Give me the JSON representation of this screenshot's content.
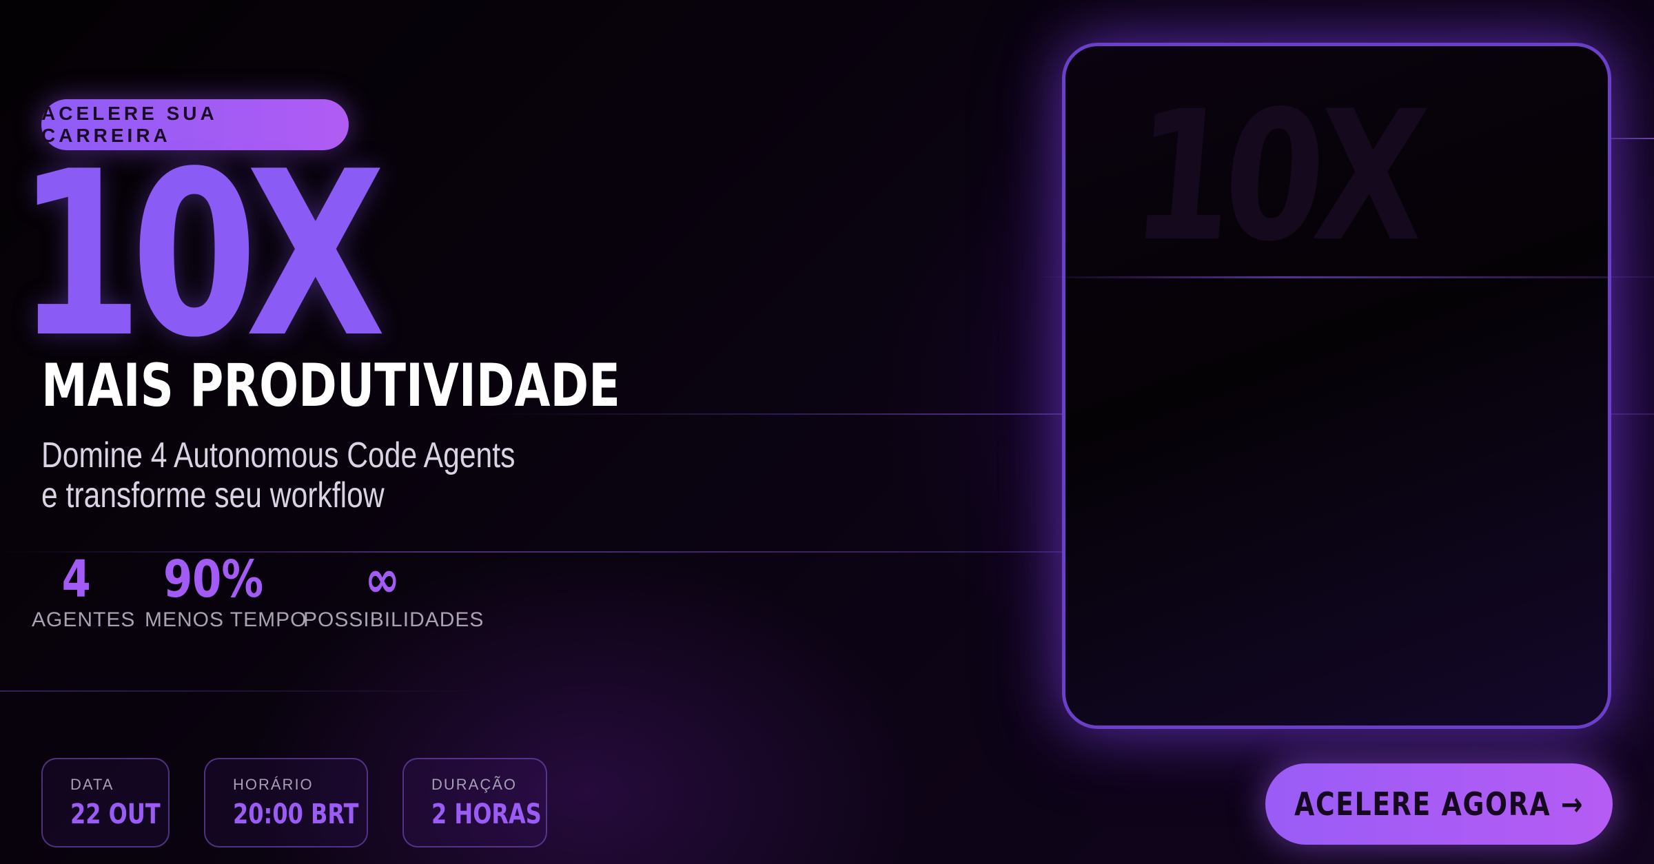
{
  "badge": "ACELERE SUA CARREIRA",
  "hero": {
    "big_text": "10X",
    "headline": "MAIS PRODUTIVIDADE",
    "subtitle_line1": "Domine 4 Autonomous Code Agents",
    "subtitle_line2": "e transforme seu workflow"
  },
  "stats": [
    {
      "value": "4",
      "label": "AGENTES"
    },
    {
      "value": "90%",
      "label": "MENOS TEMPO"
    },
    {
      "value": "∞",
      "label": "POSSIBILIDADES"
    }
  ],
  "event": {
    "date_label": "DATA",
    "date_value": "22 OUT",
    "time_label": "HORÁRIO",
    "time_value": "20:00 BRT",
    "duration_label": "DURAÇÃO",
    "duration_value": "2 HORAS"
  },
  "frame": {
    "ghost_text": "10X"
  },
  "cta": {
    "label": "ACELERE AGORA →"
  },
  "colors": {
    "accent": "#8a5cf5",
    "accent_light": "#b05cf3",
    "background": "#07020a",
    "frame_border": "#6a40c8"
  }
}
